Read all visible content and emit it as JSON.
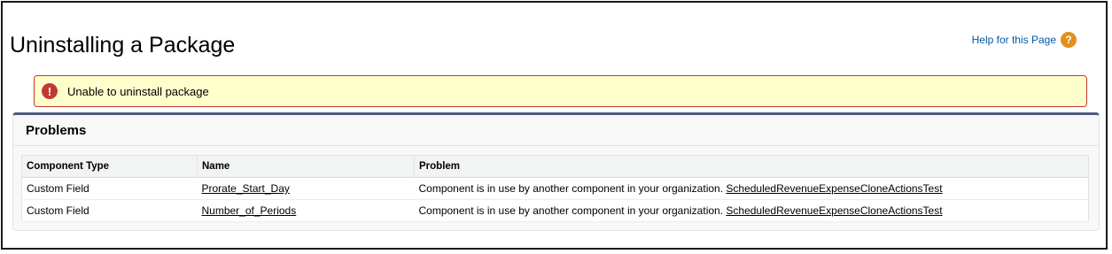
{
  "page": {
    "title": "Uninstalling a Package",
    "help_label": "Help for this Page",
    "help_icon": "question-icon"
  },
  "banner": {
    "icon": "error-icon",
    "message": "Unable to uninstall package"
  },
  "problems": {
    "title": "Problems",
    "columns": [
      "Component Type",
      "Name",
      "Problem"
    ],
    "rows": [
      {
        "type": "Custom Field",
        "name": "Prorate_Start_Day",
        "problem_text": "Component is in use by another component in your organization.",
        "problem_link": "ScheduledRevenueExpenseCloneActionsTest"
      },
      {
        "type": "Custom Field",
        "name": "Number_of_Periods",
        "problem_text": "Component is in use by another component in your organization.",
        "problem_link": "ScheduledRevenueExpenseCloneActionsTest"
      }
    ]
  },
  "colors": {
    "help_link": "#015ba7",
    "help_icon": "#e2901f",
    "error_icon": "#c23934",
    "banner_bg": "#ffffcc",
    "panel_accent": "#4a5c7f"
  }
}
